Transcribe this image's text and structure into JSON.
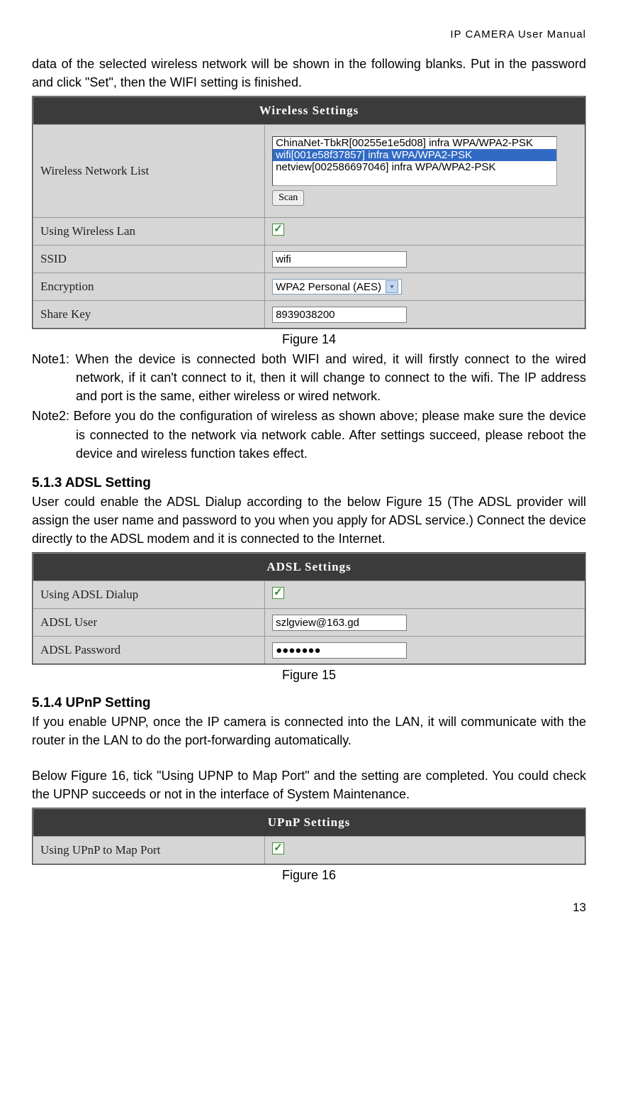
{
  "header": {
    "title": "IP  CAMERA  User  Manual"
  },
  "intro": {
    "p1": "data of the selected wireless network will be shown in the following blanks. Put in the password and click \"Set\", then the WIFI setting is finished."
  },
  "wireless": {
    "title": "Wireless  Settings",
    "rows": {
      "network_list_label": "Wireless Network List",
      "using_lan_label": "Using Wireless Lan",
      "ssid_label": "SSID",
      "ssid_value": "wifi",
      "encryption_label": "Encryption",
      "encryption_value": "WPA2 Personal (AES)",
      "sharekey_label": "Share Key",
      "sharekey_value": "8939038200"
    },
    "list": {
      "item0": "ChinaNet-TbkR[00255e1e5d08] infra WPA/WPA2-PSK",
      "item1": "wifi[001e58f37857] infra WPA/WPA2-PSK",
      "item2": "netview[002586697046] infra WPA/WPA2-PSK"
    },
    "scan_label": "Scan"
  },
  "fig14": "Figure 14",
  "notes": {
    "note1": "Note1: When the device is connected both WIFI and wired, it will firstly connect to the wired network, if it can't connect to it, then it will change to connect to the wifi. The IP address and port is the same, either wireless or wired network.",
    "note2": "Note2: Before you do the configuration of wireless as shown above; please make sure the device is connected to the network via network cable. After settings succeed, please reboot the device and wireless function takes effect."
  },
  "section513": {
    "heading": "5.1.3   ADSL Setting",
    "p1": "User could enable the ADSL Dialup according to the below Figure 15 (The ADSL provider will assign the user name and password to you when you apply for ADSL service.) Connect the device directly to the ADSL modem and it is connected to the Internet."
  },
  "adsl": {
    "title": "ADSL  Settings",
    "rows": {
      "using_label": "Using ADSL Dialup",
      "user_label": "ADSL User",
      "user_value": "szlgview@163.gd",
      "pw_label": "ADSL Password",
      "pw_value": "●●●●●●●"
    }
  },
  "fig15": "Figure 15",
  "section514": {
    "heading": "5.1.4   UPnP Setting",
    "p1": "If you enable UPNP, once the IP camera is connected into the LAN, it will communicate with the router in the LAN to do the port-forwarding automatically.",
    "p2": "Below Figure 16, tick \"Using UPNP to Map Port\" and the setting are completed. You could check the UPNP succeeds or not in the interface of System Maintenance."
  },
  "upnp": {
    "title": "UPnP  Settings",
    "rows": {
      "using_label": "Using UPnP to Map Port"
    }
  },
  "fig16": "Figure 16",
  "page_number": "13"
}
